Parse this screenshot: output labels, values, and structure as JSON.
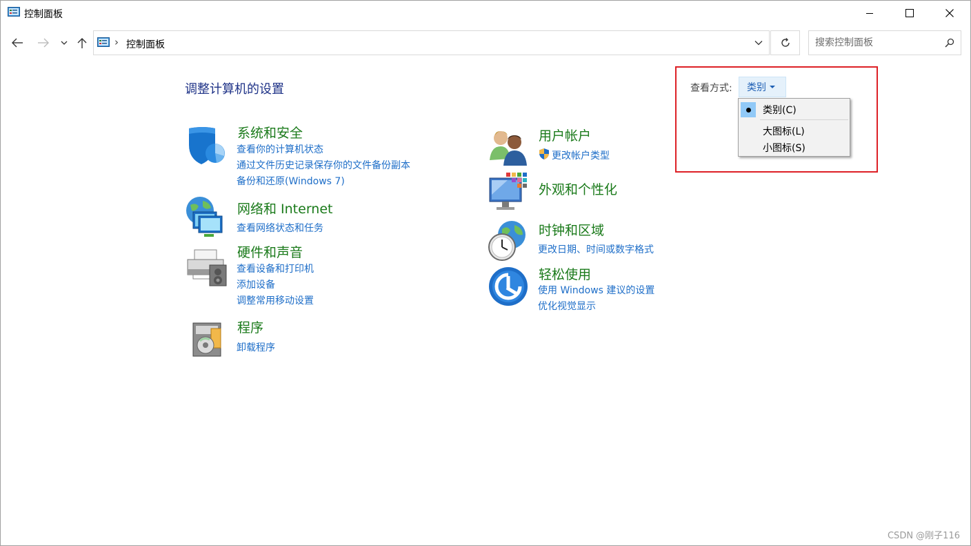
{
  "window": {
    "title": "控制面板",
    "minimize_icon": "minimize-icon",
    "maximize_icon": "maximize-icon",
    "close_icon": "close-icon"
  },
  "nav": {
    "back_icon": "arrow-left-icon",
    "forward_icon": "arrow-right-icon",
    "recent_icon": "chevron-down-icon",
    "up_icon": "arrow-up-icon"
  },
  "address": {
    "separator": "›",
    "path": "控制面板",
    "refresh_icon": "refresh-icon"
  },
  "search": {
    "placeholder": "搜索控制面板"
  },
  "main": {
    "title": "调整计算机的设置",
    "view_by_label": "查看方式:",
    "view_by_value": "类别"
  },
  "view_menu": {
    "items": [
      {
        "label": "类别(C)",
        "checked": true
      },
      {
        "label": "大图标(L)",
        "checked": false
      },
      {
        "label": "小图标(S)",
        "checked": false
      }
    ]
  },
  "categories": {
    "system_security": {
      "heading": "系统和安全",
      "links": [
        "查看你的计算机状态",
        "通过文件历史记录保存你的文件备份副本",
        "备份和还原(Windows 7)"
      ]
    },
    "network": {
      "heading": "网络和 Internet",
      "links": [
        "查看网络状态和任务"
      ]
    },
    "hardware": {
      "heading": "硬件和声音",
      "links": [
        "查看设备和打印机",
        "添加设备",
        "调整常用移动设置"
      ]
    },
    "programs": {
      "heading": "程序",
      "links": [
        "卸载程序"
      ]
    },
    "user_accounts": {
      "heading": "用户帐户",
      "links": [
        "更改帐户类型"
      ]
    },
    "appearance": {
      "heading": "外观和个性化",
      "links": []
    },
    "clock_region": {
      "heading": "时钟和区域",
      "links": [
        "更改日期、时间或数字格式"
      ]
    },
    "ease_of_access": {
      "heading": "轻松使用",
      "links": [
        "使用 Windows 建议的设置",
        "优化视觉显示"
      ]
    }
  },
  "colors": {
    "heading_green": "#1a7a1a",
    "link_blue": "#1e6ec8",
    "title_blue": "#1e3287",
    "highlight_red": "#dd1f25",
    "menu_check_bg": "#91c9f7"
  },
  "watermark": "CSDN @刚子116"
}
